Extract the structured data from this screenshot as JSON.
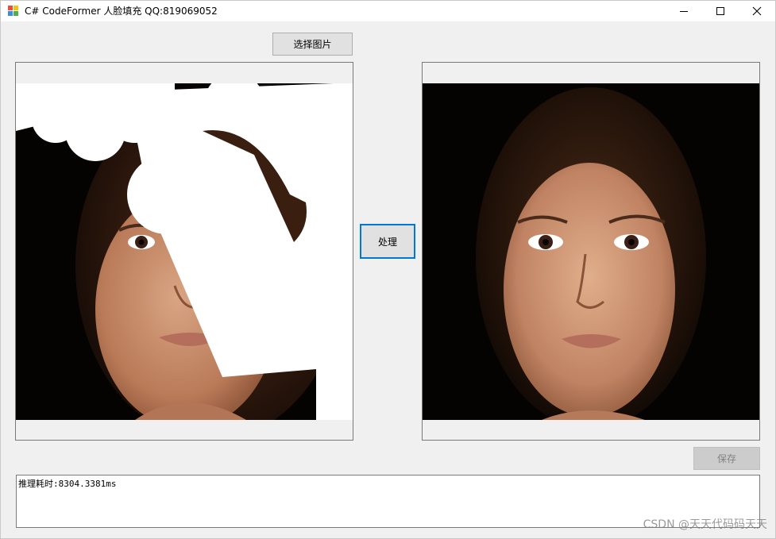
{
  "window": {
    "title": "C# CodeFormer 人脸填充 QQ:819069052"
  },
  "toolbar": {
    "select_image_label": "选择图片",
    "process_label": "处理",
    "save_label": "保存"
  },
  "output": {
    "text": "推理耗时:8304.3381ms"
  },
  "watermark": {
    "text": "CSDN @天天代码码天天"
  },
  "colors": {
    "accent": "#0078d7",
    "window_bg": "#f0f0f0",
    "button_bg": "#e1e1e1"
  },
  "icons": [
    "app-icon",
    "minimize-icon",
    "maximize-icon",
    "close-icon"
  ]
}
